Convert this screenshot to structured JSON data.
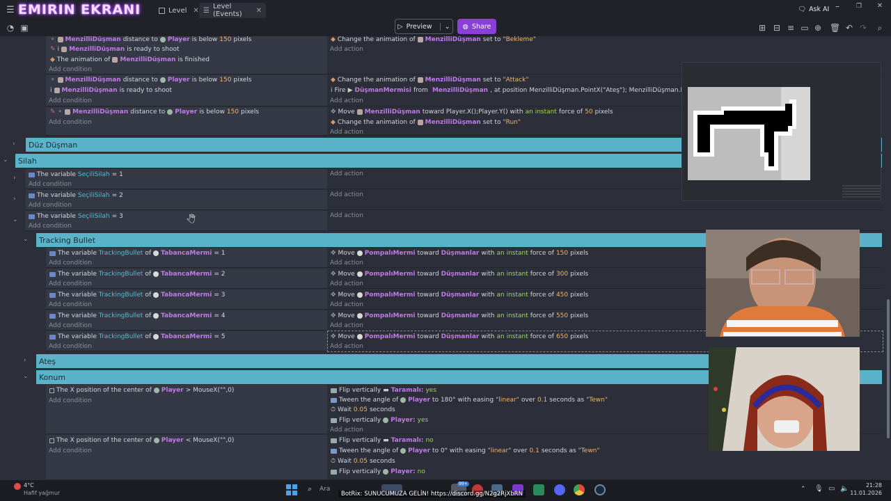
{
  "app": {
    "brand": "EMIRIN EKRANI",
    "tabs": [
      {
        "label": "Level"
      },
      {
        "label": "Level (Events)"
      }
    ],
    "ask_ai": "Ask AI",
    "preview": "Preview",
    "share": "Share"
  },
  "events": {
    "r1": {
      "c1a": "MenzilliDüşman",
      "c1b": "distance to",
      "c1c": "Player",
      "c1d": "is below",
      "c1e": "150",
      "c1f": "pixels",
      "c2a": "MenzilliDüşman",
      "c2b": "is ready to shoot",
      "c3a": "The animation of",
      "c3b": "MenzilliDüşman",
      "c3c": "is finished",
      "add_cond": "Add condition",
      "a1a": "Change the animation of",
      "a1b": "MenzilliDüşman",
      "a1c": "set to",
      "a1d": "\"Bekleme\"",
      "add_act": "Add action"
    },
    "r2": {
      "c1a": "MenzilliDüşman",
      "c1b": "distance to",
      "c1c": "Player",
      "c1d": "is below",
      "c1e": "150",
      "c1f": "pixels",
      "c2a": "MenzilliDüşman",
      "c2b": "is ready to shoot",
      "add_cond": "Add condition",
      "a1a": "Change the animation of",
      "a1b": "MenzilliDüşman",
      "a1c": "set to",
      "a1d": "\"Attack\"",
      "a2a": "Fire",
      "a2b": "DüşmanMermisi",
      "a2c": "from",
      "a2d": "MenzilliDüşman",
      "a2e": ", at position MenzilliDüşman.PointX(\"Ateş\"); MenzilliDüşman.PointY(\"A",
      "add_act": "Add action"
    },
    "r3": {
      "c1a": "MenzilliDüşman",
      "c1b": "distance to",
      "c1c": "Player",
      "c1d": "is below",
      "c1e": "150",
      "c1f": "pixels",
      "add_cond": "Add condition",
      "a1a": "Move",
      "a1b": "MenzilliDüşman",
      "a1c": "toward Player.X();Player.Y() with",
      "a1d": "an instant",
      "a1e": "force of",
      "a1f": "50",
      "a1g": "pixels",
      "a2a": "Change the animation of",
      "a2b": "MenzilliDüşman",
      "a2c": "set to",
      "a2d": "\"Run\"",
      "add_act": "Add action"
    },
    "g_duz": "Düz Düşman",
    "g_silah": "Silah",
    "silah": [
      {
        "a": "The variable",
        "b": "SeçiliSilah",
        "c": "=",
        "d": "1",
        "add_cond": "Add condition",
        "add_act": "Add action"
      },
      {
        "a": "The variable",
        "b": "SeçiliSilah",
        "c": "=",
        "d": "2",
        "add_cond": "Add condition",
        "add_act": "Add action"
      },
      {
        "a": "The variable",
        "b": "SeçiliSilah",
        "c": "=",
        "d": "3",
        "add_cond": "Add condition",
        "add_act": "Add action"
      }
    ],
    "g_tracking": "Tracking Bullet",
    "tracking": [
      {
        "a": "The variable",
        "b": "TrackingBullet",
        "c": "of",
        "d": "TabancaMermi",
        "e": "= 1",
        "m1": "Move",
        "m2": "PompalıMermi",
        "m3": "toward",
        "m4": "Düşmanlar",
        "m5": "with",
        "m6": "an instant",
        "m7": "force of",
        "m8": "150",
        "m9": "pixels"
      },
      {
        "a": "The variable",
        "b": "TrackingBullet",
        "c": "of",
        "d": "TabancaMermi",
        "e": "= 2",
        "m1": "Move",
        "m2": "PompalıMermi",
        "m3": "toward",
        "m4": "Düşmanlar",
        "m5": "with",
        "m6": "an instant",
        "m7": "force of",
        "m8": "300",
        "m9": "pixels"
      },
      {
        "a": "The variable",
        "b": "TrackingBullet",
        "c": "of",
        "d": "TabancaMermi",
        "e": "= 3",
        "m1": "Move",
        "m2": "PompalıMermi",
        "m3": "toward",
        "m4": "Düşmanlar",
        "m5": "with",
        "m6": "an instant",
        "m7": "force of",
        "m8": "450",
        "m9": "pixels"
      },
      {
        "a": "The variable",
        "b": "TrackingBullet",
        "c": "of",
        "d": "TabancaMermi",
        "e": "= 4",
        "m1": "Move",
        "m2": "PompalıMermi",
        "m3": "toward",
        "m4": "Düşmanlar",
        "m5": "with",
        "m6": "an instant",
        "m7": "force of",
        "m8": "550",
        "m9": "pixels"
      },
      {
        "a": "The variable",
        "b": "TrackingBullet",
        "c": "of",
        "d": "TabancaMermi",
        "e": "= 5",
        "m1": "Move",
        "m2": "PompalıMermi",
        "m3": "toward",
        "m4": "Düşmanlar",
        "m5": "with",
        "m6": "an instant",
        "m7": "force of",
        "m8": "650",
        "m9": "pixels"
      }
    ],
    "tracking_add_cond": "Add condition",
    "tracking_add_act": "Add action",
    "g_ates": "Ateş",
    "g_konum": "Konum",
    "konum1": {
      "c1": "The X position of the center of",
      "c2": "Player",
      "c3": "> MouseX(\"\",0)",
      "add_cond": "Add condition",
      "a1a": "Flip vertically",
      "a1b": "Taramalı:",
      "a1c": "yes",
      "a2a": "Tween the angle of",
      "a2b": "Player",
      "a2c": "to 180° with easing",
      "a2d": "\"linear\"",
      "a2e": "over",
      "a2f": "0.1",
      "a2g": "seconds as",
      "a2h": "\"Tewn\"",
      "a3a": "Wait",
      "a3b": "0.05",
      "a3c": "seconds",
      "a4a": "Flip vertically",
      "a4b": "Player:",
      "a4c": "yes",
      "add_act": "Add action"
    },
    "konum2": {
      "c1": "The X position of the center of",
      "c2": "Player",
      "c3": "< MouseX(\"\",0)",
      "add_cond": "Add condition",
      "a1a": "Flip vertically",
      "a1b": "Taramalı:",
      "a1c": "no",
      "a2a": "Tween the angle of",
      "a2b": "Player",
      "a2c": "to 0° with easing",
      "a2d": "\"linear\"",
      "a2e": "over",
      "a2f": "0.1",
      "a2g": "seconds as",
      "a2h": "\"Tewn\"",
      "a3a": "Wait",
      "a3b": "0.05",
      "a3c": "seconds",
      "a4a": "Flip vertically",
      "a4b": "Player:",
      "a4c": "no"
    }
  },
  "taskbar": {
    "weather_temp": "4°C",
    "weather_desc": "Hafif yağmur",
    "search": "Ara",
    "ticker": "BotRix: SUNUCUMUZA GELİN! https://discord.gg/N2g2RjXbRN",
    "time": "21:28",
    "date": "11.01.2026",
    "badge": "99+"
  }
}
